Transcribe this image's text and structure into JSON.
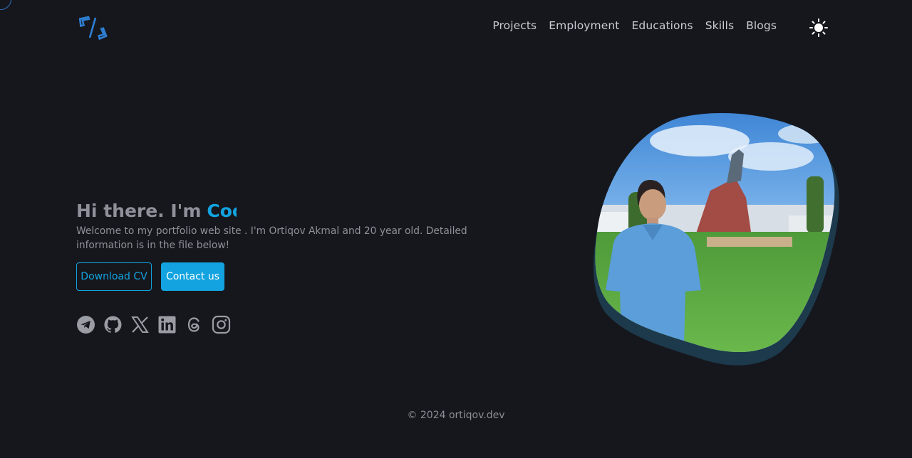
{
  "header": {
    "logo_icon": "code-brackets-icon",
    "nav": [
      "Projects",
      "Employment",
      "Educations",
      "Skills",
      "Blogs"
    ],
    "theme_icon": "sun-icon"
  },
  "hero": {
    "greeting": "Hi there. I'm",
    "typed_text": "Coo",
    "intro": "Welcome to my portfolio web site . I'm Ortiqov Akmal and 20 year old. Detailed information is in the file below!",
    "download_label": "Download CV",
    "contact_label": "Contact us",
    "socials": [
      "telegram-icon",
      "github-icon",
      "x-icon",
      "linkedin-icon",
      "threads-icon",
      "instagram-icon"
    ]
  },
  "footer": {
    "copyright": "© 2024 ortiqov.dev"
  },
  "colors": {
    "background": "#16171d",
    "accent": "#12a3e0",
    "muted_text": "#8e9199"
  }
}
